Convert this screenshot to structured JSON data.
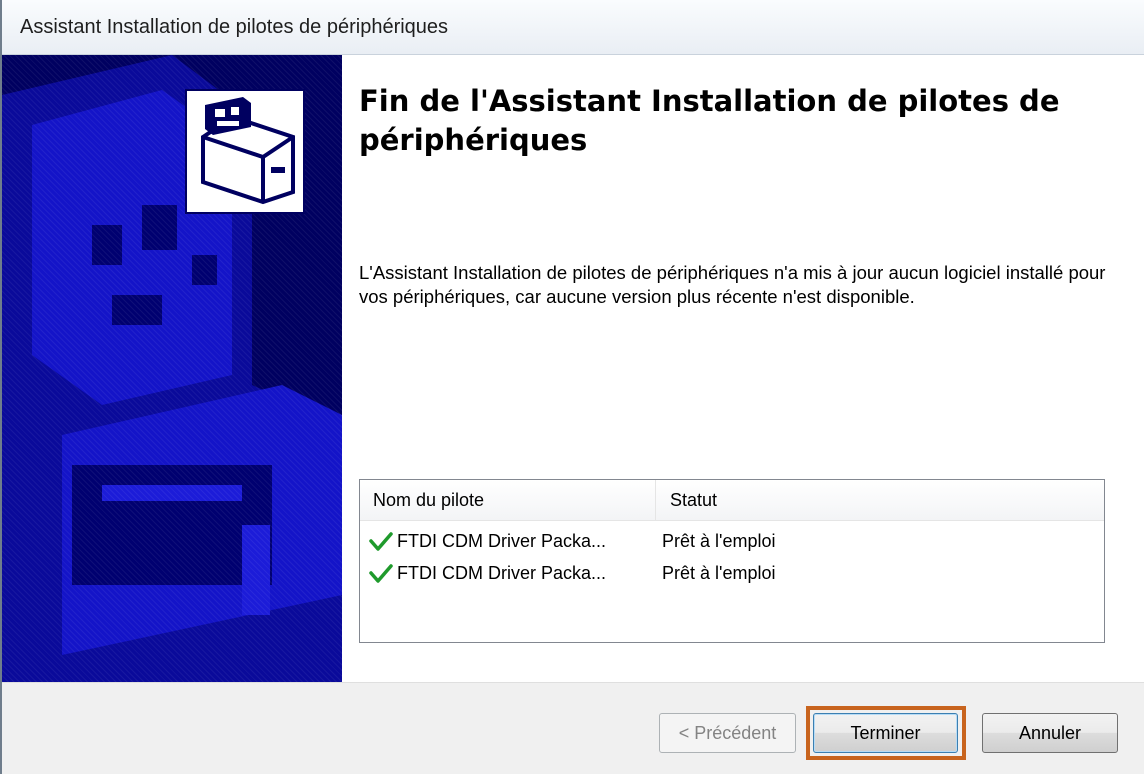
{
  "window": {
    "title": "Assistant Installation de pilotes de périphériques"
  },
  "main": {
    "heading": "Fin de l'Assistant Installation de pilotes de périphériques",
    "message": "L'Assistant Installation de pilotes de périphériques n'a mis à jour aucun logiciel installé pour vos périphériques, car aucune version plus récente n'est disponible."
  },
  "driver_list": {
    "columns": [
      "Nom du pilote",
      "Statut"
    ],
    "rows": [
      {
        "icon": "green-check-icon",
        "name": "FTDI CDM Driver Packa...",
        "status": "Prêt à l'emploi"
      },
      {
        "icon": "green-check-icon",
        "name": "FTDI CDM Driver Packa...",
        "status": "Prêt à l'emploi"
      }
    ]
  },
  "buttons": {
    "back": "< Précédent",
    "finish": "Terminer",
    "cancel": "Annuler"
  },
  "colors": {
    "banner_background": "#000060",
    "highlight": "#c8641e",
    "check": "#1f9a2c"
  }
}
